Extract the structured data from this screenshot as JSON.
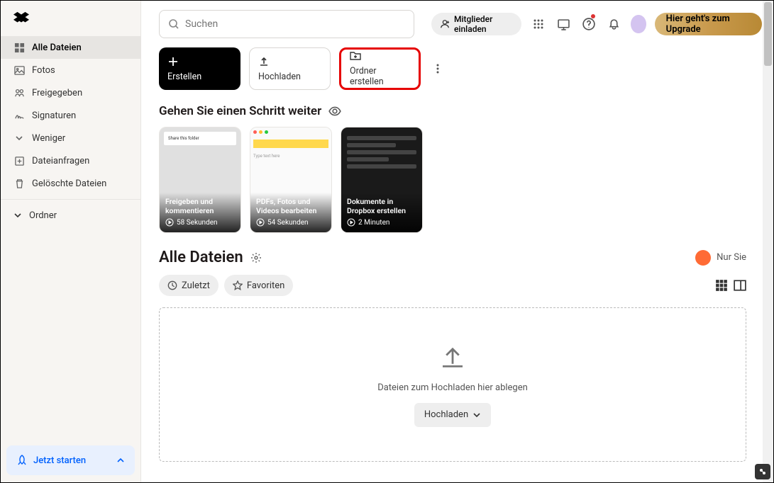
{
  "sidebar": {
    "items": [
      {
        "label": "Alle Dateien"
      },
      {
        "label": "Fotos"
      },
      {
        "label": "Freigegeben"
      },
      {
        "label": "Signaturen"
      },
      {
        "label": "Weniger"
      },
      {
        "label": "Dateianfragen"
      },
      {
        "label": "Gelöschte Dateien"
      }
    ],
    "folders_label": "Ordner",
    "get_started": "Jetzt starten"
  },
  "search": {
    "placeholder": "Suchen"
  },
  "topbar": {
    "invite": "Mitglieder einladen",
    "upgrade": "Hier geht's zum Upgrade"
  },
  "actions": {
    "create": "Erstellen",
    "upload": "Hochladen",
    "folder": "Ordner erstellen"
  },
  "tips": {
    "heading": "Gehen Sie einen Schritt weiter",
    "cards": [
      {
        "title": "Freigeben und kommentieren",
        "duration": "58 Sekunden"
      },
      {
        "title": "PDFs, Fotos und Videos bearbeiten",
        "duration": "54 Sekunden"
      },
      {
        "title": "Dokumente in Dropbox erstellen",
        "duration": "2 Minuten"
      }
    ]
  },
  "files": {
    "title": "Alle Dateien",
    "privacy": "Nur Sie",
    "chip_recent": "Zuletzt",
    "chip_fav": "Favoriten",
    "drop_text": "Dateien zum Hochladen hier ablegen",
    "upload_btn": "Hochladen"
  }
}
